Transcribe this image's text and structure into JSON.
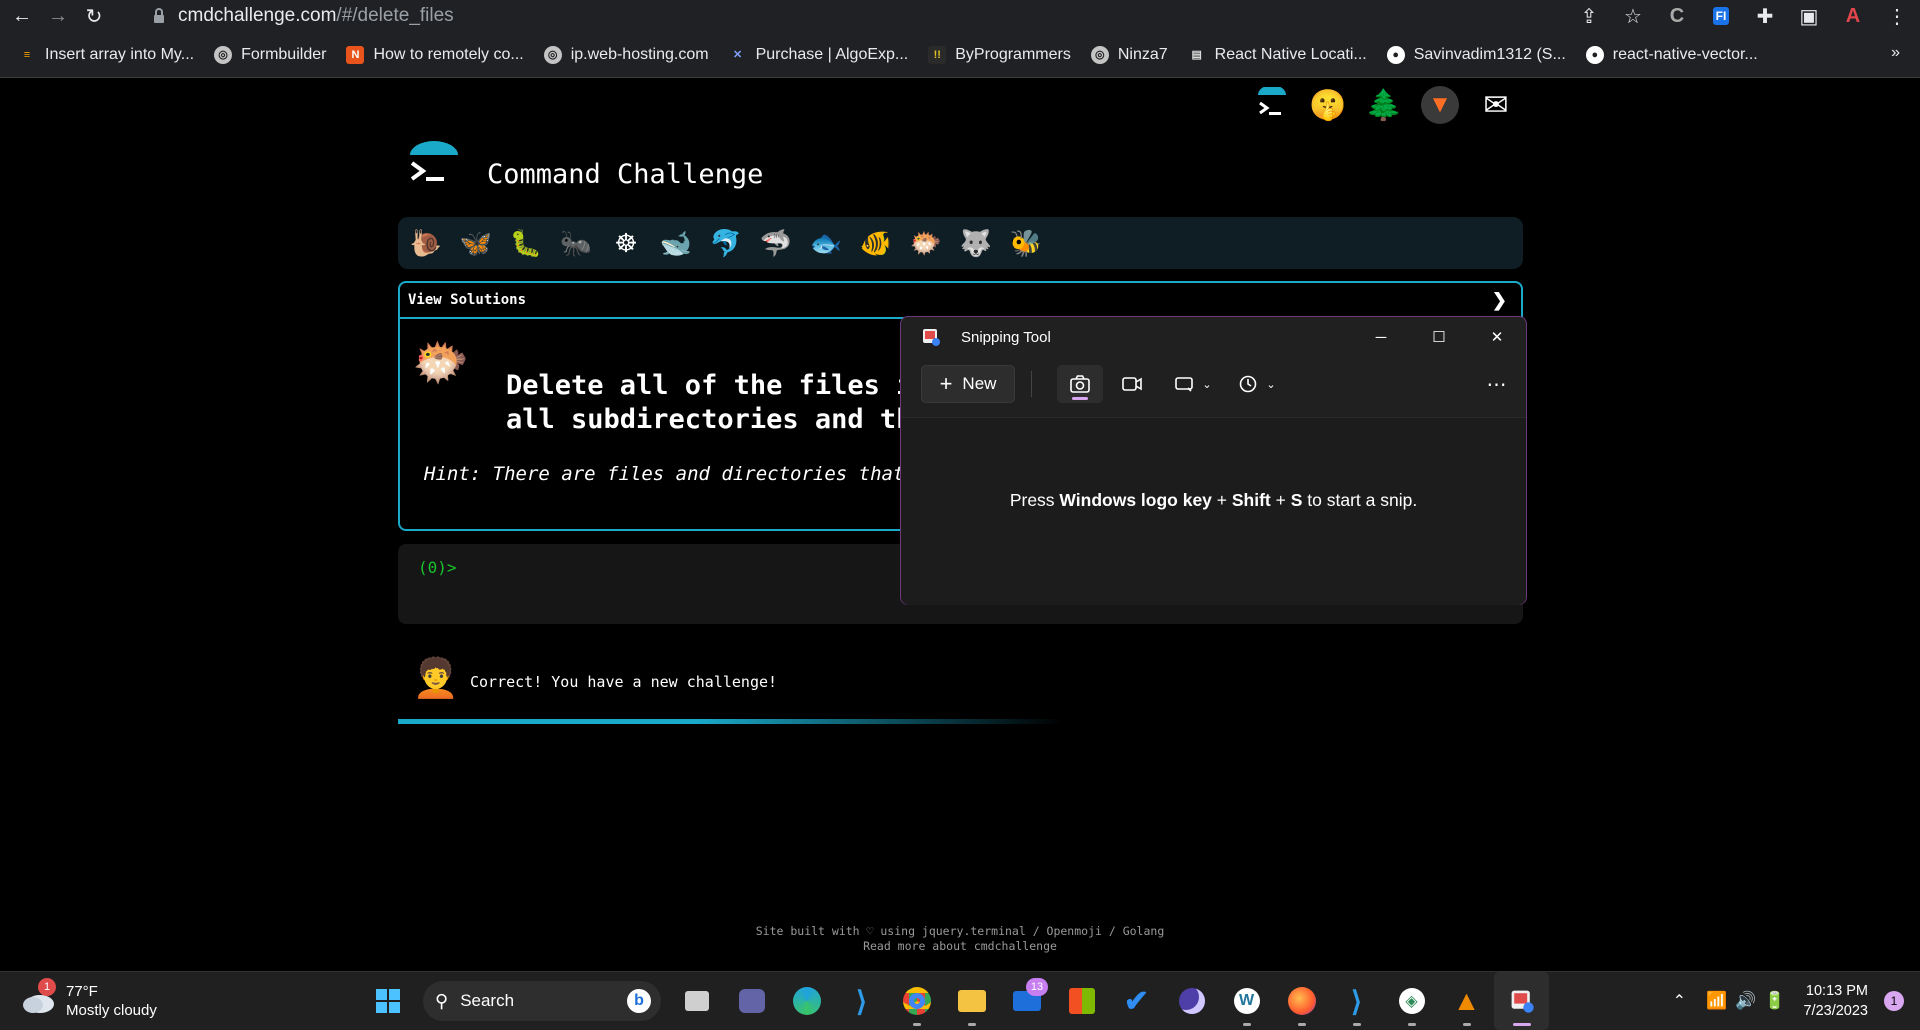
{
  "browser": {
    "url_host": "cmdchallenge.com",
    "url_path": "/#/delete_files",
    "bookmarks": [
      {
        "label": "Insert array into My...",
        "color": "#f4a300"
      },
      {
        "label": "Formbuilder",
        "color": "#c4c4c4"
      },
      {
        "label": "How to remotely co...",
        "color": "#e8541b"
      },
      {
        "label": "ip.web-hosting.com",
        "color": "#c4c4c4"
      },
      {
        "label": "Purchase | AlgoExp...",
        "color": "#4a6fd8"
      },
      {
        "label": "ByProgrammers",
        "color": "#e2c32a"
      },
      {
        "label": "Ninza7",
        "color": "#c4c4c4"
      },
      {
        "label": "React Native Locati...",
        "color": "#c4c4c4"
      },
      {
        "label": "Savinvadim1312 (S...",
        "color": "#ffffff"
      },
      {
        "label": "react-native-vector...",
        "color": "#ffffff"
      }
    ]
  },
  "page": {
    "title": "Command Challenge",
    "view_solutions": "View Solutions",
    "challenge_line1": "Delete all of the files i",
    "challenge_line2": "all subdirectories and th",
    "hint": "Hint: There are files and directories that st",
    "prompt": "(0)>",
    "feedback": "Correct! You have a new challenge!",
    "footer_line1": "Site built with ♡ using jquery.terminal / Openmoji / Golang",
    "footer_line2": "Read more about cmdchallenge",
    "progress_fraction": 0.45
  },
  "snipping_tool": {
    "title": "Snipping Tool",
    "new_label": "New",
    "message_prefix": "Press ",
    "message_bold1": "Windows logo key",
    "message_mid1": " + ",
    "message_bold2": "Shift",
    "message_mid2": " + ",
    "message_bold3": "S",
    "message_suffix": " to start a snip."
  },
  "taskbar": {
    "temperature": "77°F",
    "weather": "Mostly cloudy",
    "weather_badge": "1",
    "search_label": "Search",
    "mail_badge": "13",
    "time": "10:13 PM",
    "date": "7/23/2023",
    "notification_count": "1"
  }
}
